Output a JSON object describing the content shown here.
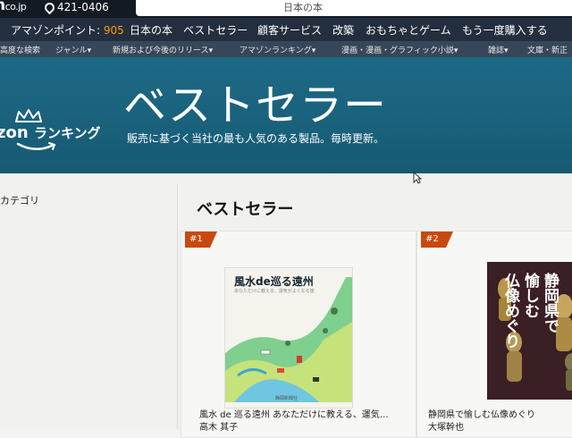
{
  "header": {
    "logo_fragment": "n",
    "logo_domain": "co.jp",
    "delivery_postcode": "421-0406",
    "search_text": "日本の本"
  },
  "nav": {
    "points_label": "アマゾンポイント:",
    "points_value": "905",
    "items": [
      "日本の本",
      "ベストセラー",
      "顧客サービス",
      "改築",
      "おもちゃとゲーム",
      "もう一度購入する"
    ]
  },
  "subnav": {
    "items": [
      "高度な検索",
      "ジャンル",
      "新規および今後のリリース",
      "アマゾンランキング",
      "漫画・漫画・グラフィック小説",
      "雑誌",
      "文庫・新正"
    ]
  },
  "banner": {
    "brand_fragment": "zon",
    "ranking_label": "ランキング",
    "title": "ベストセラー",
    "subtitle": "販売に基づく当社の最も人気のある製品。毎時更新。"
  },
  "sidebar": {
    "category_label": "カテゴリ"
  },
  "main": {
    "section_title": "ベストセラー",
    "products": [
      {
        "rank": "#1",
        "cover_title": "風水de巡る遠州",
        "cover_subtitle": "あなただけに教える、運気がよくなる旅",
        "cover_publisher": "静岡新聞社",
        "title": "風水 de 巡る遠州 あなただけに教える、運気…",
        "author": "高木 其子"
      },
      {
        "rank": "#2",
        "cover_title": "静岡県で愉しむ仏像めぐり",
        "cover_line1": "静岡県で",
        "cover_line2": "愉しむ",
        "cover_line3": "仏像めぐり",
        "title": "静岡県で愉しむ仏像めぐり",
        "author": "大塚幹也"
      }
    ]
  },
  "colors": {
    "header_bg": "#131a22",
    "nav_bg": "#232f3e",
    "subnav_bg": "#37475a",
    "banner_bg": "#1a617d",
    "points_accent": "#ff9900",
    "rank_badge": "#c9480e"
  }
}
